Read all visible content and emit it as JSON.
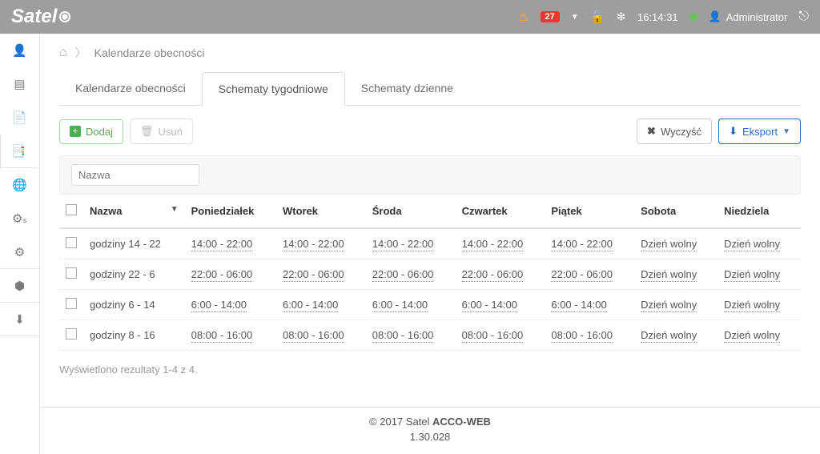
{
  "header": {
    "logo": "Satel",
    "alerts_count": "27",
    "time": "16:14:31",
    "user": "Administrator"
  },
  "breadcrumb": {
    "title": "Kalendarze obecności"
  },
  "tabs": {
    "attendance": "Kalendarze obecności",
    "weekly": "Schematy tygodniowe",
    "daily": "Schematy dzienne"
  },
  "toolbar": {
    "add": "Dodaj",
    "delete": "Usuń",
    "clear": "Wyczyść",
    "export": "Eksport"
  },
  "filter": {
    "name_placeholder": "Nazwa"
  },
  "columns": {
    "name": "Nazwa",
    "mon": "Poniedziałek",
    "tue": "Wtorek",
    "wed": "Środa",
    "thu": "Czwartek",
    "fri": "Piątek",
    "sat": "Sobota",
    "sun": "Niedziela"
  },
  "free_day": "Dzień wolny",
  "rows": [
    {
      "name": "godziny 14 - 22",
      "mon": "14:00 - 22:00",
      "tue": "14:00 - 22:00",
      "wed": "14:00 - 22:00",
      "thu": "14:00 - 22:00",
      "fri": "14:00 - 22:00",
      "sat": "Dzień wolny",
      "sun": "Dzień wolny"
    },
    {
      "name": "godziny 22 - 6",
      "mon": "22:00 - 06:00",
      "tue": "22:00 - 06:00",
      "wed": "22:00 - 06:00",
      "thu": "22:00 - 06:00",
      "fri": "22:00 - 06:00",
      "sat": "Dzień wolny",
      "sun": "Dzień wolny"
    },
    {
      "name": "godziny 6 - 14",
      "mon": "6:00 - 14:00",
      "tue": "6:00 - 14:00",
      "wed": "6:00 - 14:00",
      "thu": "6:00 - 14:00",
      "fri": "6:00 - 14:00",
      "sat": "Dzień wolny",
      "sun": "Dzień wolny"
    },
    {
      "name": "godziny 8 - 16",
      "mon": "08:00 - 16:00",
      "tue": "08:00 - 16:00",
      "wed": "08:00 - 16:00",
      "thu": "08:00 - 16:00",
      "fri": "08:00 - 16:00",
      "sat": "Dzień wolny",
      "sun": "Dzień wolny"
    }
  ],
  "results_text": "Wyświetlono rezultaty 1-4 z 4.",
  "footer": {
    "copyright_prefix": "© 2017 Satel ",
    "product": "ACCO-WEB",
    "version": "1.30.028"
  }
}
